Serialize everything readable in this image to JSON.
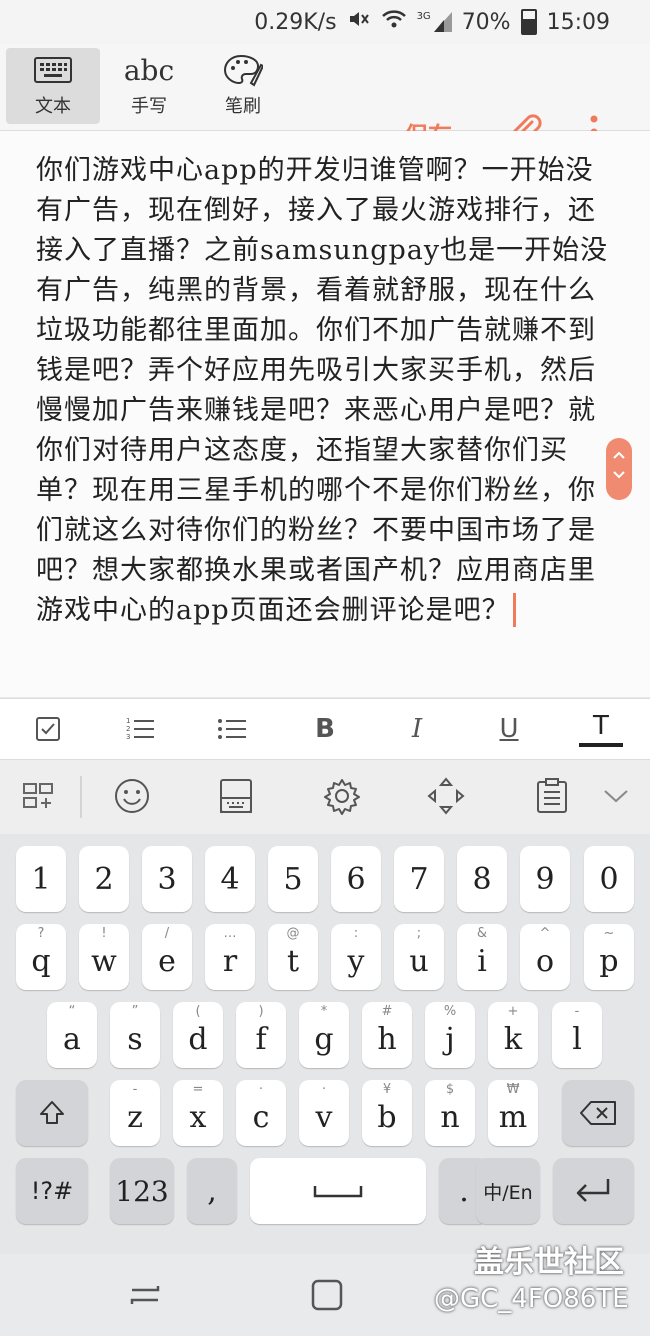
{
  "status_bar": {
    "speed": "0.29K/s",
    "battery": "70%",
    "time": "15:09",
    "network": "3G"
  },
  "toolbar": {
    "tools": [
      {
        "label": "文本",
        "icon": "keyboard-icon"
      },
      {
        "label": "手写",
        "icon": "abc-handwriting-icon",
        "icon_text": "abc"
      },
      {
        "label": "笔刷",
        "icon": "palette-icon"
      }
    ],
    "save_label": "保存",
    "accent_color": "#f07a5a"
  },
  "editor": {
    "content": "你们游戏中心app的开发归谁管啊？一开始没有广告，现在倒好，接入了最火游戏排行，还接入了直播？之前samsungpay也是一开始没有广告，纯黑的背景，看着就舒服，现在什么垃圾功能都往里面加。你们不加广告就赚不到钱是吧？弄个好应用先吸引大家买手机，然后慢慢加广告来赚钱是吧？来恶心用户是吧？就你们对待用户这态度，还指望大家替你们买单？现在用三星手机的哪个不是你们粉丝，你们就这么对待你们的粉丝？不要中国市场了是吧？想大家都换水果或者国产机？应用商店里游戏中心的app页面还会删评论是吧？"
  },
  "format_bar": {
    "items": [
      {
        "name": "checkbox-icon",
        "text": ""
      },
      {
        "name": "numbered-list-icon",
        "text": ""
      },
      {
        "name": "bullet-list-icon",
        "text": ""
      },
      {
        "name": "bold-icon",
        "text": "B"
      },
      {
        "name": "italic-icon",
        "text": "I"
      },
      {
        "name": "underline-icon",
        "text": "U"
      },
      {
        "name": "text-color-icon",
        "text": "T"
      }
    ]
  },
  "keyboard": {
    "number_row": [
      "1",
      "2",
      "3",
      "4",
      "5",
      "6",
      "7",
      "8",
      "9",
      "0"
    ],
    "row1": [
      {
        "k": "q",
        "h": "?"
      },
      {
        "k": "w",
        "h": "!"
      },
      {
        "k": "e",
        "h": "/"
      },
      {
        "k": "r",
        "h": "…"
      },
      {
        "k": "t",
        "h": "@"
      },
      {
        "k": "y",
        "h": ":"
      },
      {
        "k": "u",
        "h": ";"
      },
      {
        "k": "i",
        "h": "&"
      },
      {
        "k": "o",
        "h": "^"
      },
      {
        "k": "p",
        "h": "~"
      }
    ],
    "row2": [
      {
        "k": "a",
        "h": "“"
      },
      {
        "k": "s",
        "h": "”"
      },
      {
        "k": "d",
        "h": "("
      },
      {
        "k": "f",
        "h": ")"
      },
      {
        "k": "g",
        "h": "*"
      },
      {
        "k": "h",
        "h": "#"
      },
      {
        "k": "j",
        "h": "%"
      },
      {
        "k": "k",
        "h": "+"
      },
      {
        "k": "l",
        "h": "-"
      }
    ],
    "row3": [
      {
        "k": "z",
        "h": "-"
      },
      {
        "k": "x",
        "h": "="
      },
      {
        "k": "c",
        "h": "·"
      },
      {
        "k": "v",
        "h": "·"
      },
      {
        "k": "b",
        "h": "¥"
      },
      {
        "k": "n",
        "h": "$"
      },
      {
        "k": "m",
        "h": "₩"
      }
    ],
    "symbols_label": "!?#",
    "numbers_label": "123",
    "comma": ",",
    "period": ".",
    "lang_label": "中/En"
  },
  "watermark": {
    "line1": "盖乐世社区",
    "line2": "@GC_4FO86TE"
  }
}
